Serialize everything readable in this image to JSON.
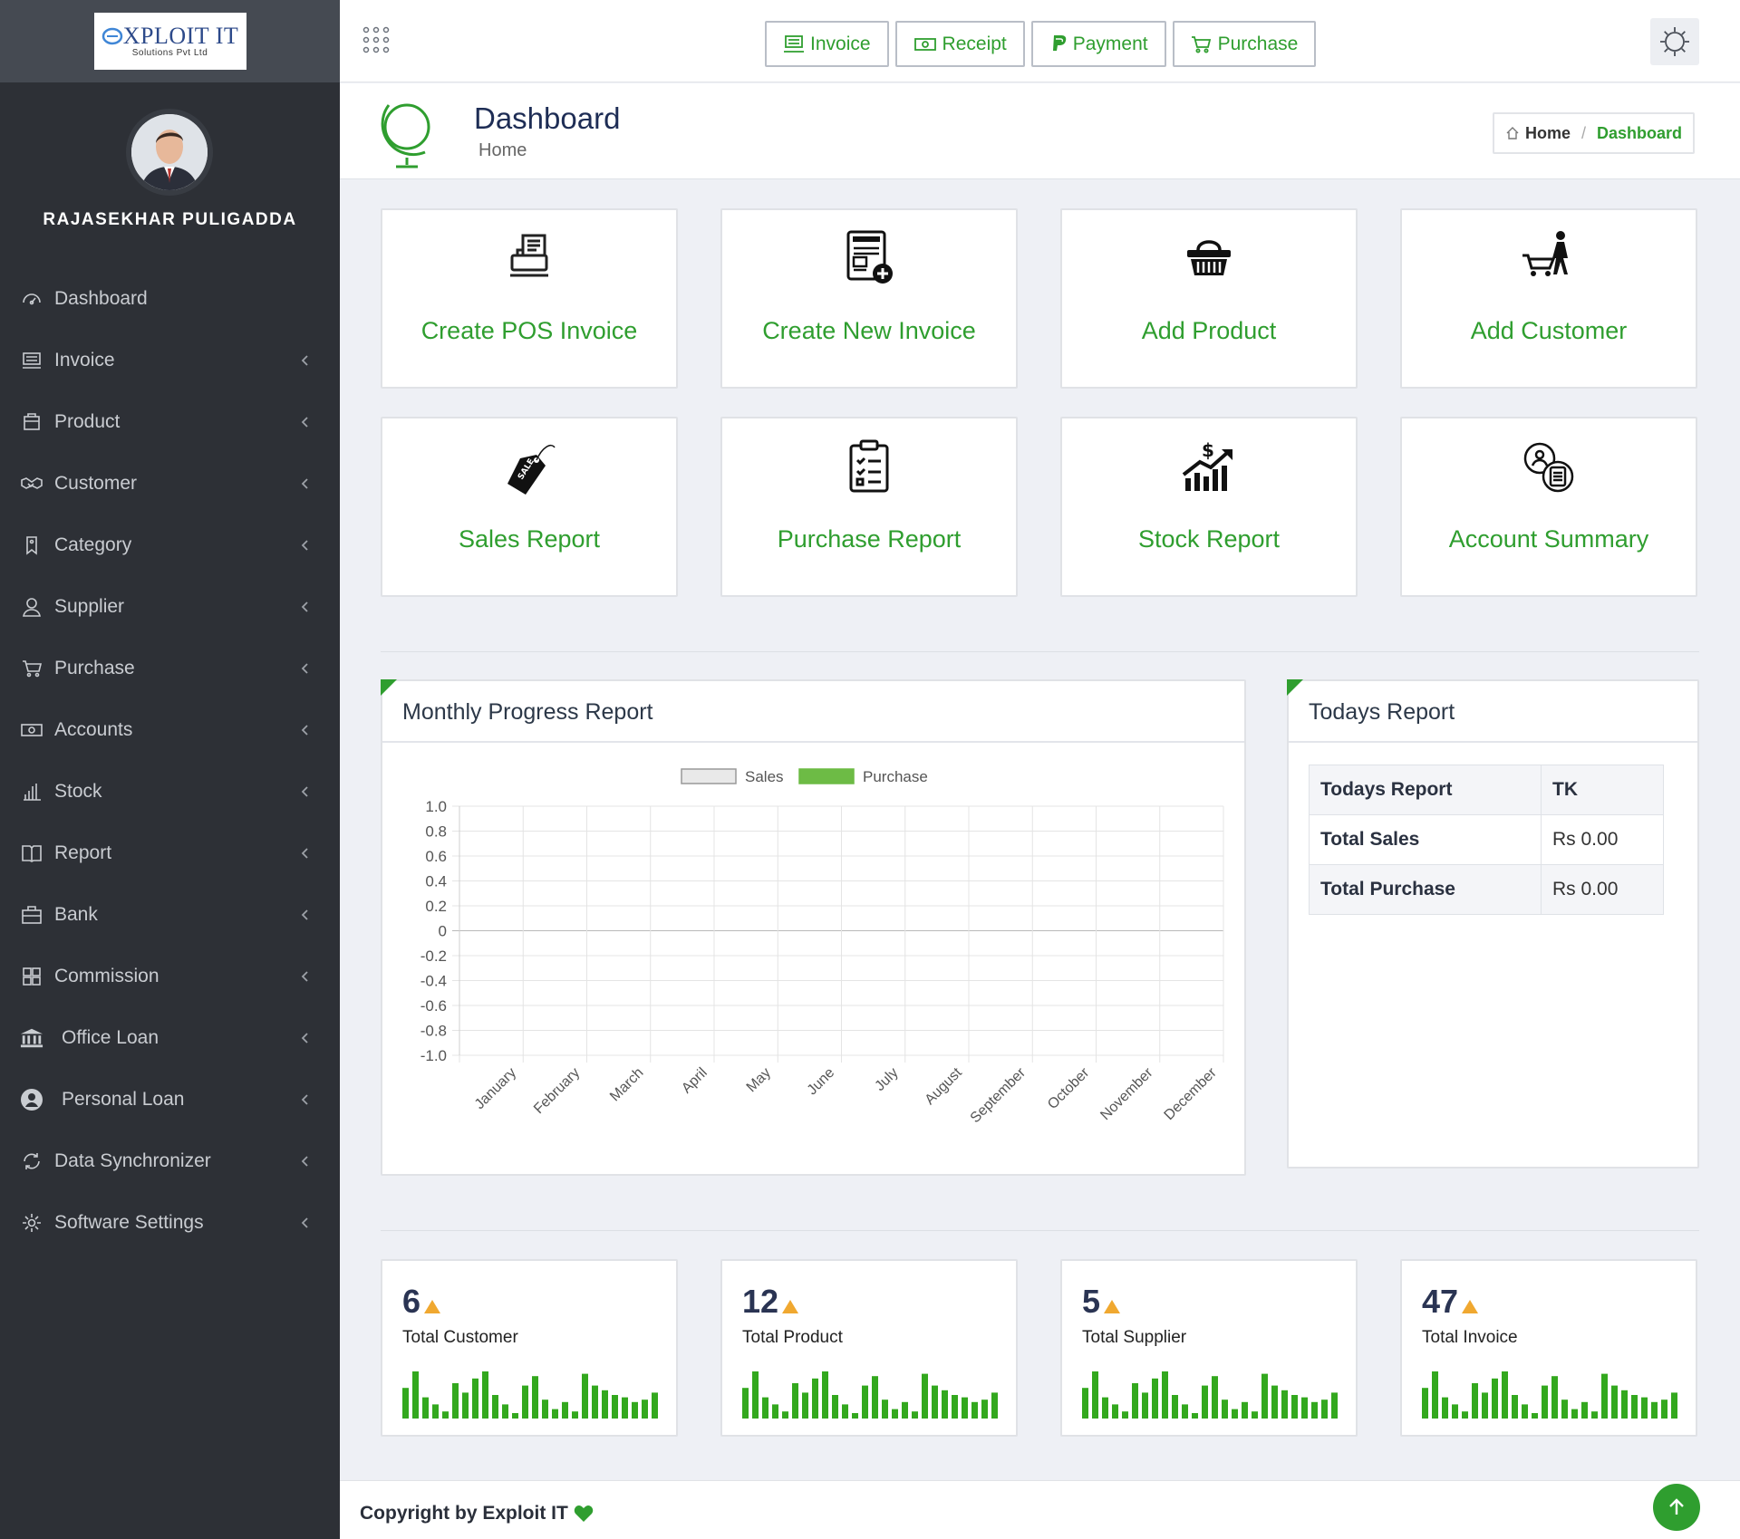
{
  "brand": {
    "logo_main": "XPLOIT IT",
    "logo_sub": "Solutions Pvt Ltd",
    "accent": "#2f9e2f",
    "sidebar_bg": "#2d3036"
  },
  "user": {
    "name": "RAJASEKHAR PULIGADDA"
  },
  "sidebar": {
    "items": [
      {
        "label": "Dashboard",
        "icon": "dashboard-icon"
      },
      {
        "label": "Invoice",
        "icon": "invoice-icon"
      },
      {
        "label": "Product",
        "icon": "product-icon"
      },
      {
        "label": "Customer",
        "icon": "handshake-icon"
      },
      {
        "label": "Category",
        "icon": "tag-icon"
      },
      {
        "label": "Supplier",
        "icon": "user-icon"
      },
      {
        "label": "Purchase",
        "icon": "cart-icon"
      },
      {
        "label": "Accounts",
        "icon": "money-icon"
      },
      {
        "label": "Stock",
        "icon": "bar-chart-icon"
      },
      {
        "label": "Report",
        "icon": "book-icon"
      },
      {
        "label": "Bank",
        "icon": "briefcase-icon"
      },
      {
        "label": "Commission",
        "icon": "grid-icon"
      },
      {
        "label": "Office Loan",
        "icon": "bank-icon"
      },
      {
        "label": "Personal Loan",
        "icon": "user-circle-icon"
      },
      {
        "label": "Data Synchronizer",
        "icon": "sync-icon"
      },
      {
        "label": "Software Settings",
        "icon": "gear-icon"
      }
    ]
  },
  "topbar": {
    "buttons": [
      {
        "label": "Invoice",
        "icon": "invoice-icon"
      },
      {
        "label": "Receipt",
        "icon": "money-icon"
      },
      {
        "label": "Payment",
        "icon": "paypal-icon"
      },
      {
        "label": "Purchase",
        "icon": "cart-icon"
      }
    ]
  },
  "header": {
    "title": "Dashboard",
    "subtitle": "Home"
  },
  "breadcrumb": {
    "home": "Home",
    "current": "Dashboard"
  },
  "tiles": [
    {
      "label": "Create POS Invoice",
      "icon": "pos-register-icon"
    },
    {
      "label": "Create New Invoice",
      "icon": "new-invoice-icon"
    },
    {
      "label": "Add Product",
      "icon": "basket-icon"
    },
    {
      "label": "Add Customer",
      "icon": "shopper-icon"
    },
    {
      "label": "Sales Report",
      "icon": "sale-tag-icon"
    },
    {
      "label": "Purchase Report",
      "icon": "clipboard-checklist-icon"
    },
    {
      "label": "Stock Report",
      "icon": "stock-growth-icon"
    },
    {
      "label": "Account Summary",
      "icon": "account-summary-icon"
    }
  ],
  "monthly_panel": {
    "title": "Monthly Progress Report"
  },
  "chart_data": {
    "type": "bar",
    "title": "",
    "xlabel": "",
    "ylabel": "",
    "categories": [
      "January",
      "February",
      "March",
      "April",
      "May",
      "June",
      "July",
      "August",
      "September",
      "October",
      "November",
      "December"
    ],
    "series": [
      {
        "name": "Sales",
        "color": "#e9e9e9",
        "values": [
          0,
          0,
          0,
          0,
          0,
          0,
          0,
          0,
          0,
          0,
          0,
          0
        ]
      },
      {
        "name": "Purchase",
        "color": "#6dbb45",
        "values": [
          0,
          0,
          0,
          0,
          0,
          0,
          0,
          0,
          0,
          0,
          0,
          0
        ]
      }
    ],
    "ylim": [
      -1.0,
      1.0
    ],
    "yticks": [
      "1.0",
      "0.8",
      "0.6",
      "0.4",
      "0.2",
      "0",
      "-0.2",
      "-0.4",
      "-0.6",
      "-0.8",
      "-1.0"
    ],
    "grid": true,
    "legend": "top"
  },
  "todays_panel": {
    "title": "Todays Report",
    "table": {
      "header": [
        "Todays Report",
        "TK"
      ],
      "rows": [
        [
          "Total Sales",
          "Rs 0.00"
        ],
        [
          "Total Purchase",
          "Rs 0.00"
        ]
      ]
    }
  },
  "stats": [
    {
      "value": "6",
      "label": "Total Customer"
    },
    {
      "value": "12",
      "label": "Total Product"
    },
    {
      "value": "5",
      "label": "Total Supplier"
    },
    {
      "value": "47",
      "label": "Total Invoice"
    }
  ],
  "footer": {
    "copyright": "Copyright by Exploit IT"
  }
}
